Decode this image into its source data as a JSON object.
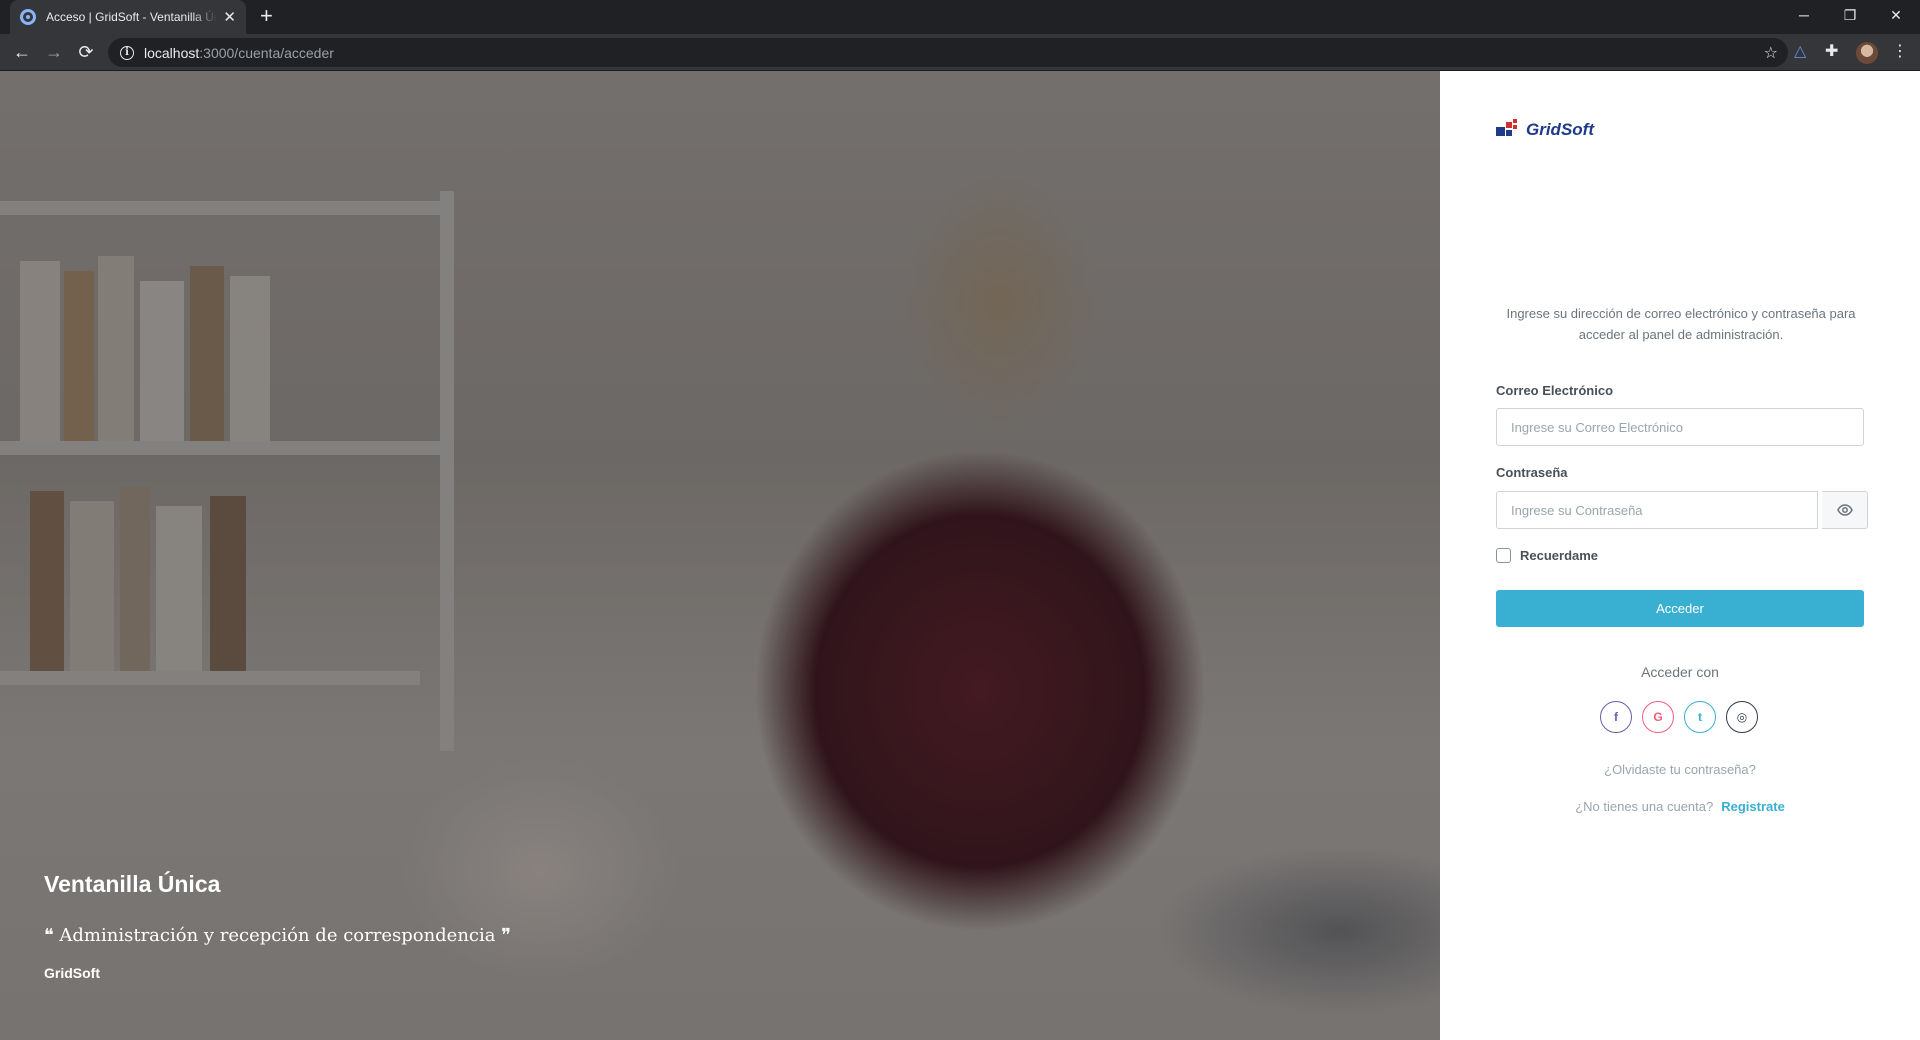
{
  "browser": {
    "tab_title": "Acceso | GridSoft - Ventanilla Única",
    "new_tab": "+",
    "url_host": "localhost",
    "url_path": ":3000/cuenta/acceder",
    "controls": {
      "minimize": "─",
      "restore": "❐",
      "close": "✕"
    }
  },
  "hero": {
    "title": "Ventanilla Única",
    "quote": "❝ Administración y recepción de correspondencia ❞",
    "author": "GridSoft"
  },
  "brand": {
    "name": "GridSoft",
    "colors": {
      "blue": "#1f3a8a",
      "red": "#d32f2f"
    }
  },
  "login": {
    "intro": "Ingrese su dirección de correo electrónico y contraseña para acceder al panel de administración.",
    "email_label": "Correo Electrónico",
    "email_placeholder": "Ingrese su Correo Electrónico",
    "password_label": "Contraseña",
    "password_placeholder": "Ingrese su Contraseña",
    "remember_label": "Recuerdame",
    "submit_label": "Acceder",
    "alt_title": "Acceder con",
    "socials": [
      {
        "name": "facebook",
        "glyph": "f",
        "color": "#6b5eae"
      },
      {
        "name": "google",
        "glyph": "G",
        "color": "#fa5c7c"
      },
      {
        "name": "twitter",
        "glyph": "t",
        "color": "#39afd1"
      },
      {
        "name": "github",
        "glyph": "◎",
        "color": "#313a46"
      }
    ],
    "forgot": "¿Olvidaste tu contraseña?",
    "no_account": "¿No tienes una cuenta?",
    "signup": "Registrate",
    "accent_color": "#39afd1"
  }
}
